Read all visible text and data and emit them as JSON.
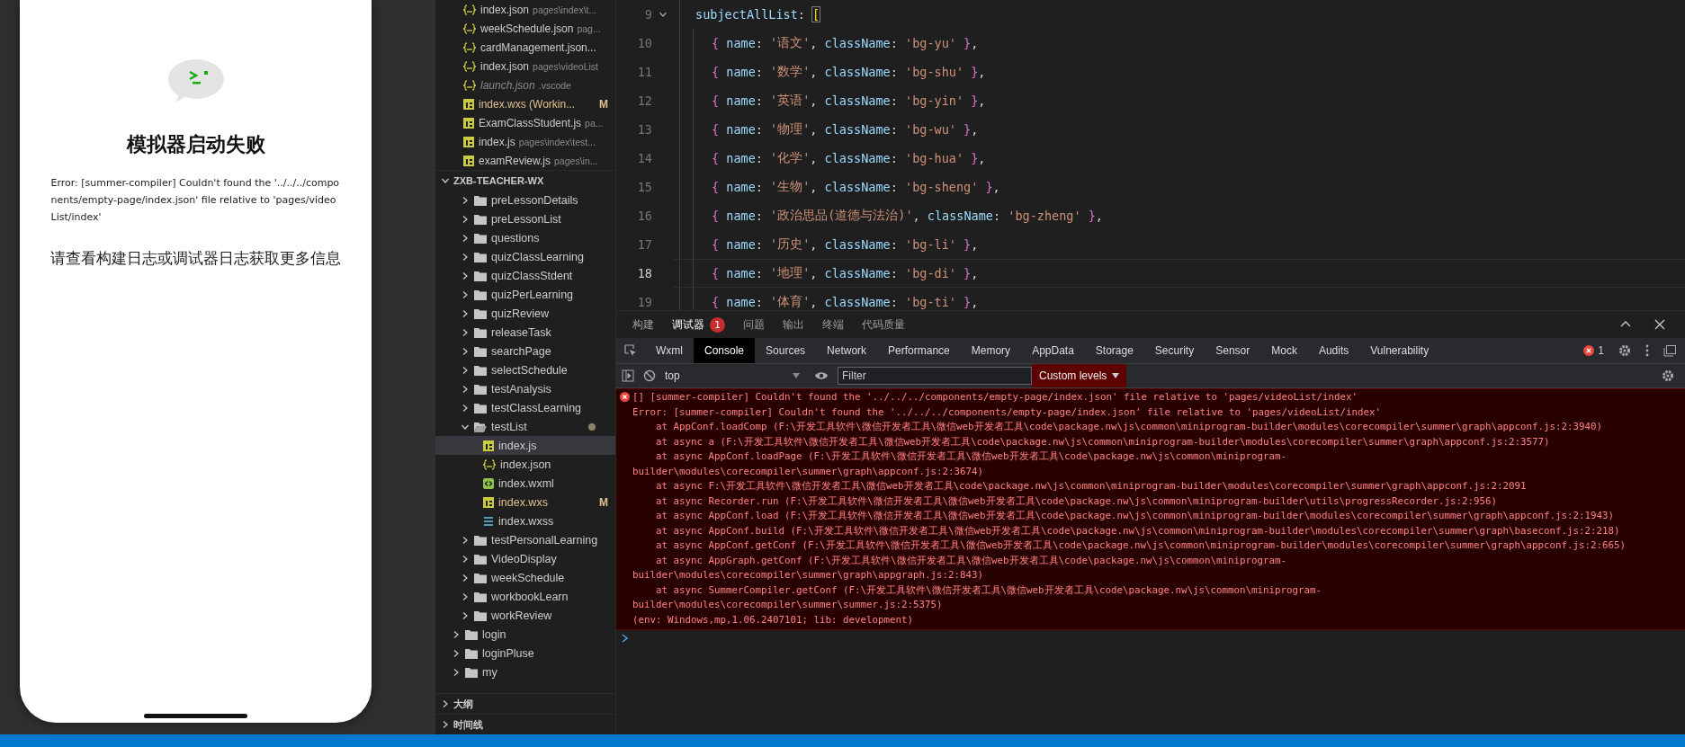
{
  "simulator": {
    "title": "模拟器启动失败",
    "error": "Error: [summer-compiler] Couldn't found the '../../../components/empty-page/index.json' file relative to 'pages/videoList/index'",
    "hint": "请查看构建日志或调试器日志获取更多信息"
  },
  "explorer": {
    "open_editors": [
      {
        "kind": "json",
        "name": "index.json",
        "description": "pages\\index\\t...",
        "modified": false,
        "preview": false
      },
      {
        "kind": "json",
        "name": "weekSchedule.json",
        "description": "pag...",
        "modified": false,
        "preview": false
      },
      {
        "kind": "json",
        "name": "cardManagement.json...",
        "modified": false,
        "preview": false
      },
      {
        "kind": "json",
        "name": "index.json",
        "description": "pages\\videoList",
        "modified": false,
        "preview": false
      },
      {
        "kind": "json",
        "name": "launch.json",
        "description": ".vscode",
        "modified": false,
        "preview": true
      },
      {
        "kind": "js",
        "name": "index.wxs (Workin...",
        "badge": "M",
        "modified": true,
        "preview": false
      },
      {
        "kind": "js",
        "name": "ExamClassStudent.js",
        "description": "pa...",
        "modified": false,
        "preview": false
      },
      {
        "kind": "js",
        "name": "index.js",
        "description": "pages\\index\\test...",
        "modified": false,
        "preview": false
      },
      {
        "kind": "js",
        "name": "examReview.js",
        "description": "pages\\in...",
        "modified": false,
        "preview": false
      }
    ],
    "project": {
      "name": "ZXB-TEACHER-WX",
      "expanded": true
    },
    "tree": [
      {
        "kind": "hidden-parent",
        "children": [
          {
            "kind": "folder",
            "name": "preLessonDetails",
            "expanded": false,
            "selected": false,
            "modified": false
          },
          {
            "kind": "folder",
            "name": "preLessonList",
            "expanded": false,
            "selected": false,
            "modified": false
          },
          {
            "kind": "folder",
            "name": "questions",
            "expanded": false,
            "selected": false,
            "modified": false
          },
          {
            "kind": "folder",
            "name": "quizClassLearning",
            "expanded": false,
            "selected": false,
            "modified": false
          },
          {
            "kind": "folder",
            "name": "quizClassStdent",
            "expanded": false,
            "selected": false,
            "modified": false
          },
          {
            "kind": "folder",
            "name": "quizPerLearning",
            "expanded": false,
            "selected": false,
            "modified": false
          },
          {
            "kind": "folder",
            "name": "quizReview",
            "expanded": false,
            "selected": false,
            "modified": false
          },
          {
            "kind": "folder",
            "name": "releaseTask",
            "expanded": false,
            "selected": false,
            "modified": false
          },
          {
            "kind": "folder",
            "name": "searchPage",
            "expanded": false,
            "selected": false,
            "modified": false
          },
          {
            "kind": "folder",
            "name": "selectSchedule",
            "expanded": false,
            "selected": false,
            "modified": false
          },
          {
            "kind": "folder",
            "name": "testAnalysis",
            "expanded": false,
            "selected": false,
            "modified": false
          },
          {
            "kind": "folder",
            "name": "testClassLearning",
            "expanded": false,
            "selected": false,
            "modified": false
          },
          {
            "kind": "folder",
            "name": "testList",
            "expanded": true,
            "selected": false,
            "modified": true,
            "children": [
              {
                "kind": "js",
                "name": "index.js",
                "selected": true,
                "modified": false
              },
              {
                "kind": "json",
                "name": "index.json",
                "selected": false,
                "modified": false
              },
              {
                "kind": "wxml",
                "name": "index.wxml",
                "selected": false,
                "modified": false
              },
              {
                "kind": "js",
                "name": "index.wxs",
                "selected": false,
                "modified": true,
                "badge": "M"
              },
              {
                "kind": "css",
                "name": "index.wxss",
                "selected": false,
                "modified": false
              }
            ]
          },
          {
            "kind": "folder",
            "name": "testPersonalLearning",
            "expanded": false,
            "selected": false,
            "modified": false
          },
          {
            "kind": "folder",
            "name": "VideoDisplay",
            "expanded": false,
            "selected": false,
            "modified": false
          },
          {
            "kind": "folder",
            "name": "weekSchedule",
            "expanded": false,
            "selected": false,
            "modified": false
          },
          {
            "kind": "folder",
            "name": "workbookLearn",
            "expanded": false,
            "selected": false,
            "modified": false
          },
          {
            "kind": "folder",
            "name": "workReview",
            "expanded": false,
            "selected": false,
            "modified": false
          }
        ]
      },
      {
        "kind": "folder",
        "name": "login",
        "expanded": false,
        "selected": false,
        "modified": false
      },
      {
        "kind": "folder",
        "name": "loginPluse",
        "expanded": false,
        "selected": false,
        "modified": false
      },
      {
        "kind": "folder",
        "name": "my",
        "expanded": false,
        "selected": false,
        "modified": false
      }
    ],
    "sections": [
      {
        "label": "大纲",
        "expanded": false
      },
      {
        "label": "时间线",
        "expanded": false
      }
    ]
  },
  "editor": {
    "lines": [
      {
        "number": "9",
        "current": false,
        "foldable": true,
        "tokens": [
          {
            "kind": "key",
            "text": "subjectAllList"
          },
          {
            "kind": "punct",
            "text": ": "
          },
          {
            "kind": "bracket",
            "text": "["
          }
        ],
        "children": [
          {
            "number": "10",
            "current": false,
            "foldable": false,
            "tokens": [
              {
                "kind": "brace",
                "text": "{ "
              },
              {
                "kind": "key",
                "text": "name"
              },
              {
                "kind": "punct",
                "text": ": "
              },
              {
                "kind": "string",
                "text": "'语文'"
              },
              {
                "kind": "punct",
                "text": ", "
              },
              {
                "kind": "key",
                "text": "className"
              },
              {
                "kind": "punct",
                "text": ": "
              },
              {
                "kind": "string",
                "text": "'bg-yu'"
              },
              {
                "kind": "brace",
                "text": " }"
              },
              {
                "kind": "punct",
                "text": ","
              }
            ]
          },
          {
            "number": "11",
            "current": false,
            "foldable": false,
            "tokens": [
              {
                "kind": "brace",
                "text": "{ "
              },
              {
                "kind": "key",
                "text": "name"
              },
              {
                "kind": "punct",
                "text": ": "
              },
              {
                "kind": "string",
                "text": "'数学'"
              },
              {
                "kind": "punct",
                "text": ", "
              },
              {
                "kind": "key",
                "text": "className"
              },
              {
                "kind": "punct",
                "text": ": "
              },
              {
                "kind": "string",
                "text": "'bg-shu'"
              },
              {
                "kind": "brace",
                "text": " }"
              },
              {
                "kind": "punct",
                "text": ","
              }
            ]
          },
          {
            "number": "12",
            "current": false,
            "foldable": false,
            "tokens": [
              {
                "kind": "brace",
                "text": "{ "
              },
              {
                "kind": "key",
                "text": "name"
              },
              {
                "kind": "punct",
                "text": ": "
              },
              {
                "kind": "string",
                "text": "'英语'"
              },
              {
                "kind": "punct",
                "text": ", "
              },
              {
                "kind": "key",
                "text": "className"
              },
              {
                "kind": "punct",
                "text": ": "
              },
              {
                "kind": "string",
                "text": "'bg-yin'"
              },
              {
                "kind": "brace",
                "text": " }"
              },
              {
                "kind": "punct",
                "text": ","
              }
            ]
          },
          {
            "number": "13",
            "current": false,
            "foldable": false,
            "tokens": [
              {
                "kind": "brace",
                "text": "{ "
              },
              {
                "kind": "key",
                "text": "name"
              },
              {
                "kind": "punct",
                "text": ": "
              },
              {
                "kind": "string",
                "text": "'物理'"
              },
              {
                "kind": "punct",
                "text": ", "
              },
              {
                "kind": "key",
                "text": "className"
              },
              {
                "kind": "punct",
                "text": ": "
              },
              {
                "kind": "string",
                "text": "'bg-wu'"
              },
              {
                "kind": "brace",
                "text": " }"
              },
              {
                "kind": "punct",
                "text": ","
              }
            ]
          },
          {
            "number": "14",
            "current": false,
            "foldable": false,
            "tokens": [
              {
                "kind": "brace",
                "text": "{ "
              },
              {
                "kind": "key",
                "text": "name"
              },
              {
                "kind": "punct",
                "text": ": "
              },
              {
                "kind": "string",
                "text": "'化学'"
              },
              {
                "kind": "punct",
                "text": ", "
              },
              {
                "kind": "key",
                "text": "className"
              },
              {
                "kind": "punct",
                "text": ": "
              },
              {
                "kind": "string",
                "text": "'bg-hua'"
              },
              {
                "kind": "brace",
                "text": " }"
              },
              {
                "kind": "punct",
                "text": ","
              }
            ]
          },
          {
            "number": "15",
            "current": false,
            "foldable": false,
            "tokens": [
              {
                "kind": "brace",
                "text": "{ "
              },
              {
                "kind": "key",
                "text": "name"
              },
              {
                "kind": "punct",
                "text": ": "
              },
              {
                "kind": "string",
                "text": "'生物'"
              },
              {
                "kind": "punct",
                "text": ", "
              },
              {
                "kind": "key",
                "text": "className"
              },
              {
                "kind": "punct",
                "text": ": "
              },
              {
                "kind": "string",
                "text": "'bg-sheng'"
              },
              {
                "kind": "brace",
                "text": " }"
              },
              {
                "kind": "punct",
                "text": ","
              }
            ]
          },
          {
            "number": "16",
            "current": false,
            "foldable": false,
            "tokens": [
              {
                "kind": "brace",
                "text": "{ "
              },
              {
                "kind": "key",
                "text": "name"
              },
              {
                "kind": "punct",
                "text": ": "
              },
              {
                "kind": "string",
                "text": "'政治思品(道德与法治)'"
              },
              {
                "kind": "punct",
                "text": ", "
              },
              {
                "kind": "key",
                "text": "className"
              },
              {
                "kind": "punct",
                "text": ": "
              },
              {
                "kind": "string",
                "text": "'bg-zheng'"
              },
              {
                "kind": "brace",
                "text": " }"
              },
              {
                "kind": "punct",
                "text": ","
              }
            ]
          },
          {
            "number": "17",
            "current": false,
            "foldable": false,
            "tokens": [
              {
                "kind": "brace",
                "text": "{ "
              },
              {
                "kind": "key",
                "text": "name"
              },
              {
                "kind": "punct",
                "text": ": "
              },
              {
                "kind": "string",
                "text": "'历史'"
              },
              {
                "kind": "punct",
                "text": ", "
              },
              {
                "kind": "key",
                "text": "className"
              },
              {
                "kind": "punct",
                "text": ": "
              },
              {
                "kind": "string",
                "text": "'bg-li'"
              },
              {
                "kind": "brace",
                "text": " }"
              },
              {
                "kind": "punct",
                "text": ","
              }
            ]
          },
          {
            "number": "18",
            "current": true,
            "foldable": false,
            "tokens": [
              {
                "kind": "brace",
                "text": "{ "
              },
              {
                "kind": "key",
                "text": "name"
              },
              {
                "kind": "punct",
                "text": ": "
              },
              {
                "kind": "string",
                "text": "'地理'"
              },
              {
                "kind": "punct",
                "text": ", "
              },
              {
                "kind": "key",
                "text": "className"
              },
              {
                "kind": "punct",
                "text": ": "
              },
              {
                "kind": "string",
                "text": "'bg-di'"
              },
              {
                "kind": "brace",
                "text": " }"
              },
              {
                "kind": "punct",
                "text": ","
              }
            ]
          },
          {
            "number": "19",
            "current": false,
            "foldable": false,
            "tokens": [
              {
                "kind": "brace",
                "text": "{ "
              },
              {
                "kind": "key",
                "text": "name"
              },
              {
                "kind": "punct",
                "text": ": "
              },
              {
                "kind": "string",
                "text": "'体育'"
              },
              {
                "kind": "punct",
                "text": ", "
              },
              {
                "kind": "key",
                "text": "className"
              },
              {
                "kind": "punct",
                "text": ": "
              },
              {
                "kind": "string",
                "text": "'bg-ti'"
              },
              {
                "kind": "brace",
                "text": " }"
              },
              {
                "kind": "punct",
                "text": ","
              }
            ]
          }
        ]
      }
    ]
  },
  "panel": {
    "tabs": [
      {
        "label": "构建",
        "selected": false
      },
      {
        "label": "调试器",
        "selected": true,
        "badge": "1"
      },
      {
        "label": "问题",
        "selected": false
      },
      {
        "label": "输出",
        "selected": false
      },
      {
        "label": "终端",
        "selected": false
      },
      {
        "label": "代码质量",
        "selected": false
      }
    ],
    "devtools_tabs": [
      {
        "label": "Wxml",
        "selected": false
      },
      {
        "label": "Console",
        "selected": true
      },
      {
        "label": "Sources",
        "selected": false
      },
      {
        "label": "Network",
        "selected": false
      },
      {
        "label": "Performance",
        "selected": false
      },
      {
        "label": "Memory",
        "selected": false
      },
      {
        "label": "AppData",
        "selected": false
      },
      {
        "label": "Storage",
        "selected": false
      },
      {
        "label": "Security",
        "selected": false
      },
      {
        "label": "Sensor",
        "selected": false
      },
      {
        "label": "Mock",
        "selected": false
      },
      {
        "label": "Audits",
        "selected": false
      },
      {
        "label": "Vulnerability",
        "selected": false
      }
    ],
    "error_count": "1",
    "console": {
      "context": "top",
      "filter_placeholder": "Filter",
      "levels": "Custom levels",
      "error_lines": [
        "[] [summer-compiler] Couldn't found the '../../../components/empty-page/index.json' file relative to 'pages/videoList/index'",
        "Error: [summer-compiler] Couldn't found the '../../../components/empty-page/index.json' file relative to 'pages/videoList/index'",
        "    at AppConf.loadComp (F:\\开发工具软件\\微信开发者工具\\微信web开发者工具\\code\\package.nw\\js\\common\\miniprogram-builder\\modules\\corecompiler\\summer\\graph\\appconf.js:2:3940)",
        "    at async a (F:\\开发工具软件\\微信开发者工具\\微信web开发者工具\\code\\package.nw\\js\\common\\miniprogram-builder\\modules\\corecompiler\\summer\\graph\\appconf.js:2:3577)",
        "    at async AppConf.loadPage (F:\\开发工具软件\\微信开发者工具\\微信web开发者工具\\code\\package.nw\\js\\common\\miniprogram-",
        "builder\\modules\\corecompiler\\summer\\graph\\appconf.js:2:3674)",
        "    at async F:\\开发工具软件\\微信开发者工具\\微信web开发者工具\\code\\package.nw\\js\\common\\miniprogram-builder\\modules\\corecompiler\\summer\\graph\\appconf.js:2:2091",
        "    at async Recorder.run (F:\\开发工具软件\\微信开发者工具\\微信web开发者工具\\code\\package.nw\\js\\common\\miniprogram-builder\\utils\\progressRecorder.js:2:956)",
        "    at async AppConf.load (F:\\开发工具软件\\微信开发者工具\\微信web开发者工具\\code\\package.nw\\js\\common\\miniprogram-builder\\modules\\corecompiler\\summer\\graph\\appconf.js:2:1943)",
        "    at async AppConf.build (F:\\开发工具软件\\微信开发者工具\\微信web开发者工具\\code\\package.nw\\js\\common\\miniprogram-builder\\modules\\corecompiler\\summer\\graph\\baseconf.js:2:218)",
        "    at async AppConf.getConf (F:\\开发工具软件\\微信开发者工具\\微信web开发者工具\\code\\package.nw\\js\\common\\miniprogram-builder\\modules\\corecompiler\\summer\\graph\\appconf.js:2:665)",
        "    at async AppGraph.getConf (F:\\开发工具软件\\微信开发者工具\\微信web开发者工具\\code\\package.nw\\js\\common\\miniprogram-",
        "builder\\modules\\corecompiler\\summer\\graph\\appgraph.js:2:843)",
        "    at async SummerCompiler.getConf (F:\\开发工具软件\\微信开发者工具\\微信web开发者工具\\code\\package.nw\\js\\common\\miniprogram-",
        "builder\\modules\\corecompiler\\summer\\summer.js:2:5375)",
        "(env: Windows,mp,1.06.2407101; lib: development)"
      ]
    }
  }
}
